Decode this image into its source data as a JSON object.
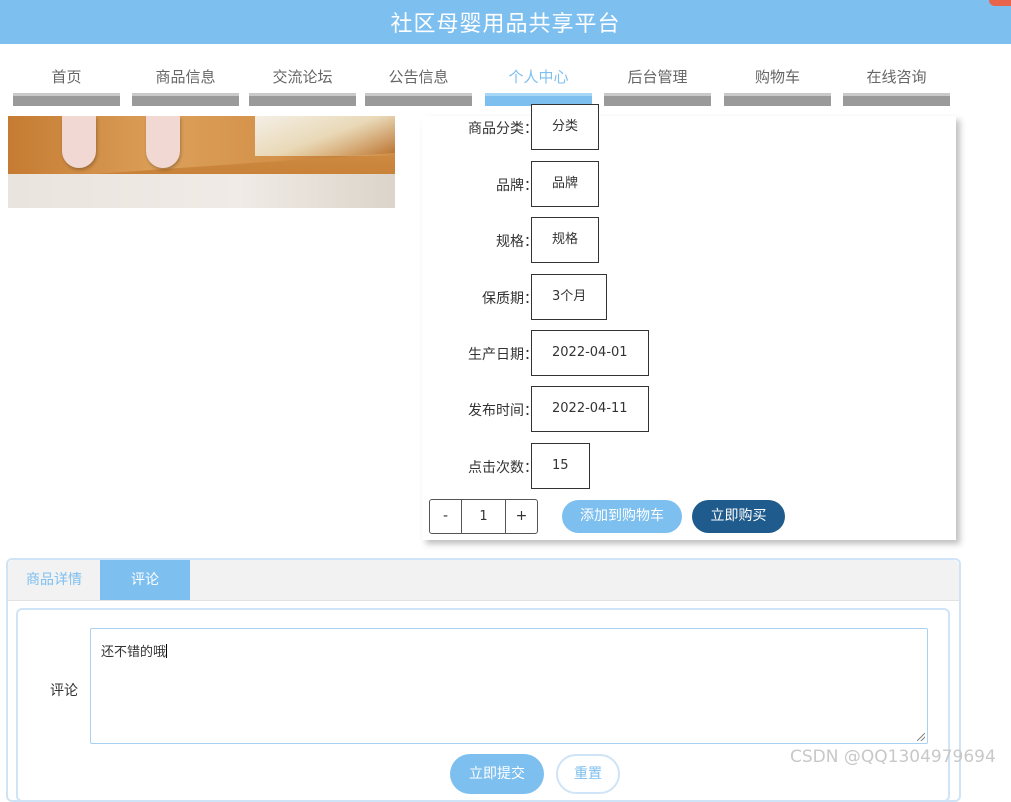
{
  "header": {
    "title": "社区母婴用品共享平台"
  },
  "nav": {
    "items": [
      {
        "label": "首页"
      },
      {
        "label": "商品信息"
      },
      {
        "label": "交流论坛"
      },
      {
        "label": "公告信息"
      },
      {
        "label": "个人中心",
        "active": true
      },
      {
        "label": "后台管理"
      },
      {
        "label": "购物车"
      },
      {
        "label": "在线咨询"
      }
    ]
  },
  "product": {
    "fields": [
      {
        "label": "商品分类：",
        "value": "分类"
      },
      {
        "label": "品牌：",
        "value": "品牌"
      },
      {
        "label": "规格：",
        "value": "规格"
      },
      {
        "label": "保质期：",
        "value": "3个月"
      },
      {
        "label": "生产日期：",
        "value": "2022-04-01"
      },
      {
        "label": "发布时间：",
        "value": "2022-04-11"
      },
      {
        "label": "点击次数：",
        "value": "15"
      }
    ],
    "quantity": {
      "minus": "-",
      "value": "1",
      "plus": "+"
    },
    "add_to_cart_label": "添加到购物车",
    "buy_now_label": "立即购买"
  },
  "tabs": [
    {
      "label": "商品详情"
    },
    {
      "label": "评论",
      "active": true
    }
  ],
  "comment": {
    "label": "评论",
    "text": "还不错的哦",
    "submit_label": "立即提交",
    "reset_label": "重置"
  },
  "watermark": "CSDN @QQ1304979694",
  "colors": {
    "primary": "#7dbfef",
    "buy_button": "#1f5b8c",
    "nav_bar": "#9a9a9a"
  }
}
